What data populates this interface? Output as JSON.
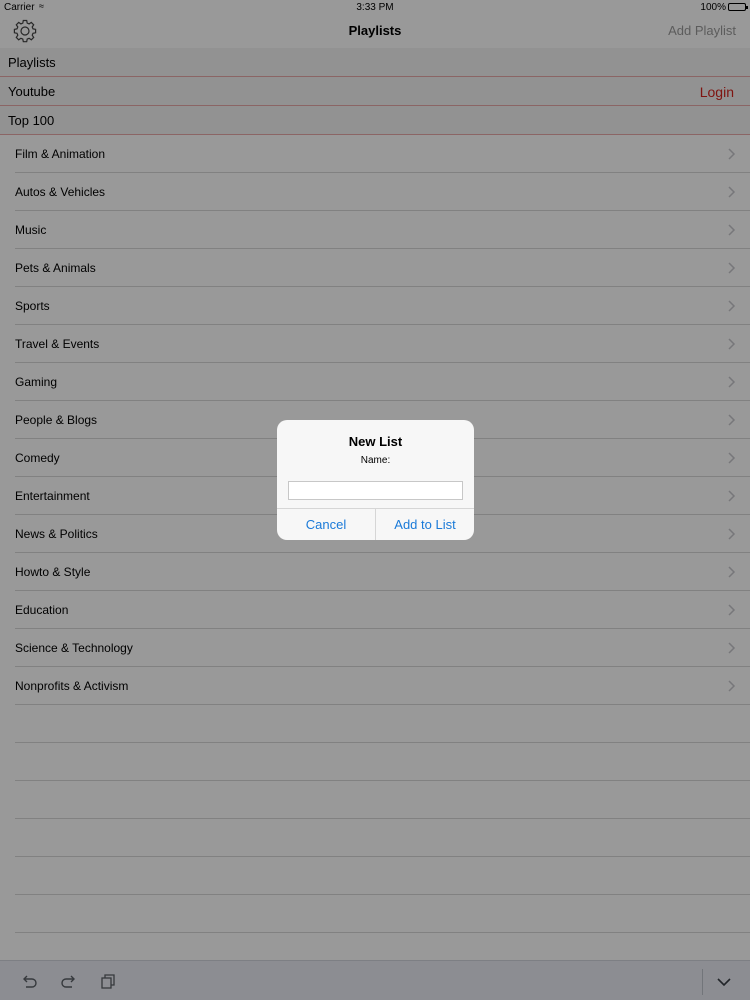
{
  "status_bar": {
    "carrier": "Carrier",
    "time": "3:33 PM",
    "battery": "100%"
  },
  "nav": {
    "title": "Playlists",
    "add_playlist": "Add Playlist",
    "settings_icon": "gear-icon"
  },
  "sections": {
    "playlists": "Playlists",
    "youtube": "Youtube",
    "login": "Login",
    "top100": "Top 100"
  },
  "categories": [
    "Film & Animation",
    "Autos & Vehicles",
    "Music",
    "Pets & Animals",
    "Sports",
    "Travel & Events",
    "Gaming",
    "People & Blogs",
    "Comedy",
    "Entertainment",
    "News & Politics",
    "Howto & Style",
    "Education",
    "Science & Technology",
    "Nonprofits & Activism"
  ],
  "alert": {
    "title": "New List",
    "message": "Name:",
    "input_value": "",
    "cancel": "Cancel",
    "confirm": "Add to List"
  },
  "toolbar": {
    "icons": [
      "undo-icon",
      "redo-icon",
      "paste-icon",
      "chevron-down-icon"
    ]
  },
  "colors": {
    "accent_red": "#d4231d",
    "button_blue": "#1a7ad8"
  }
}
